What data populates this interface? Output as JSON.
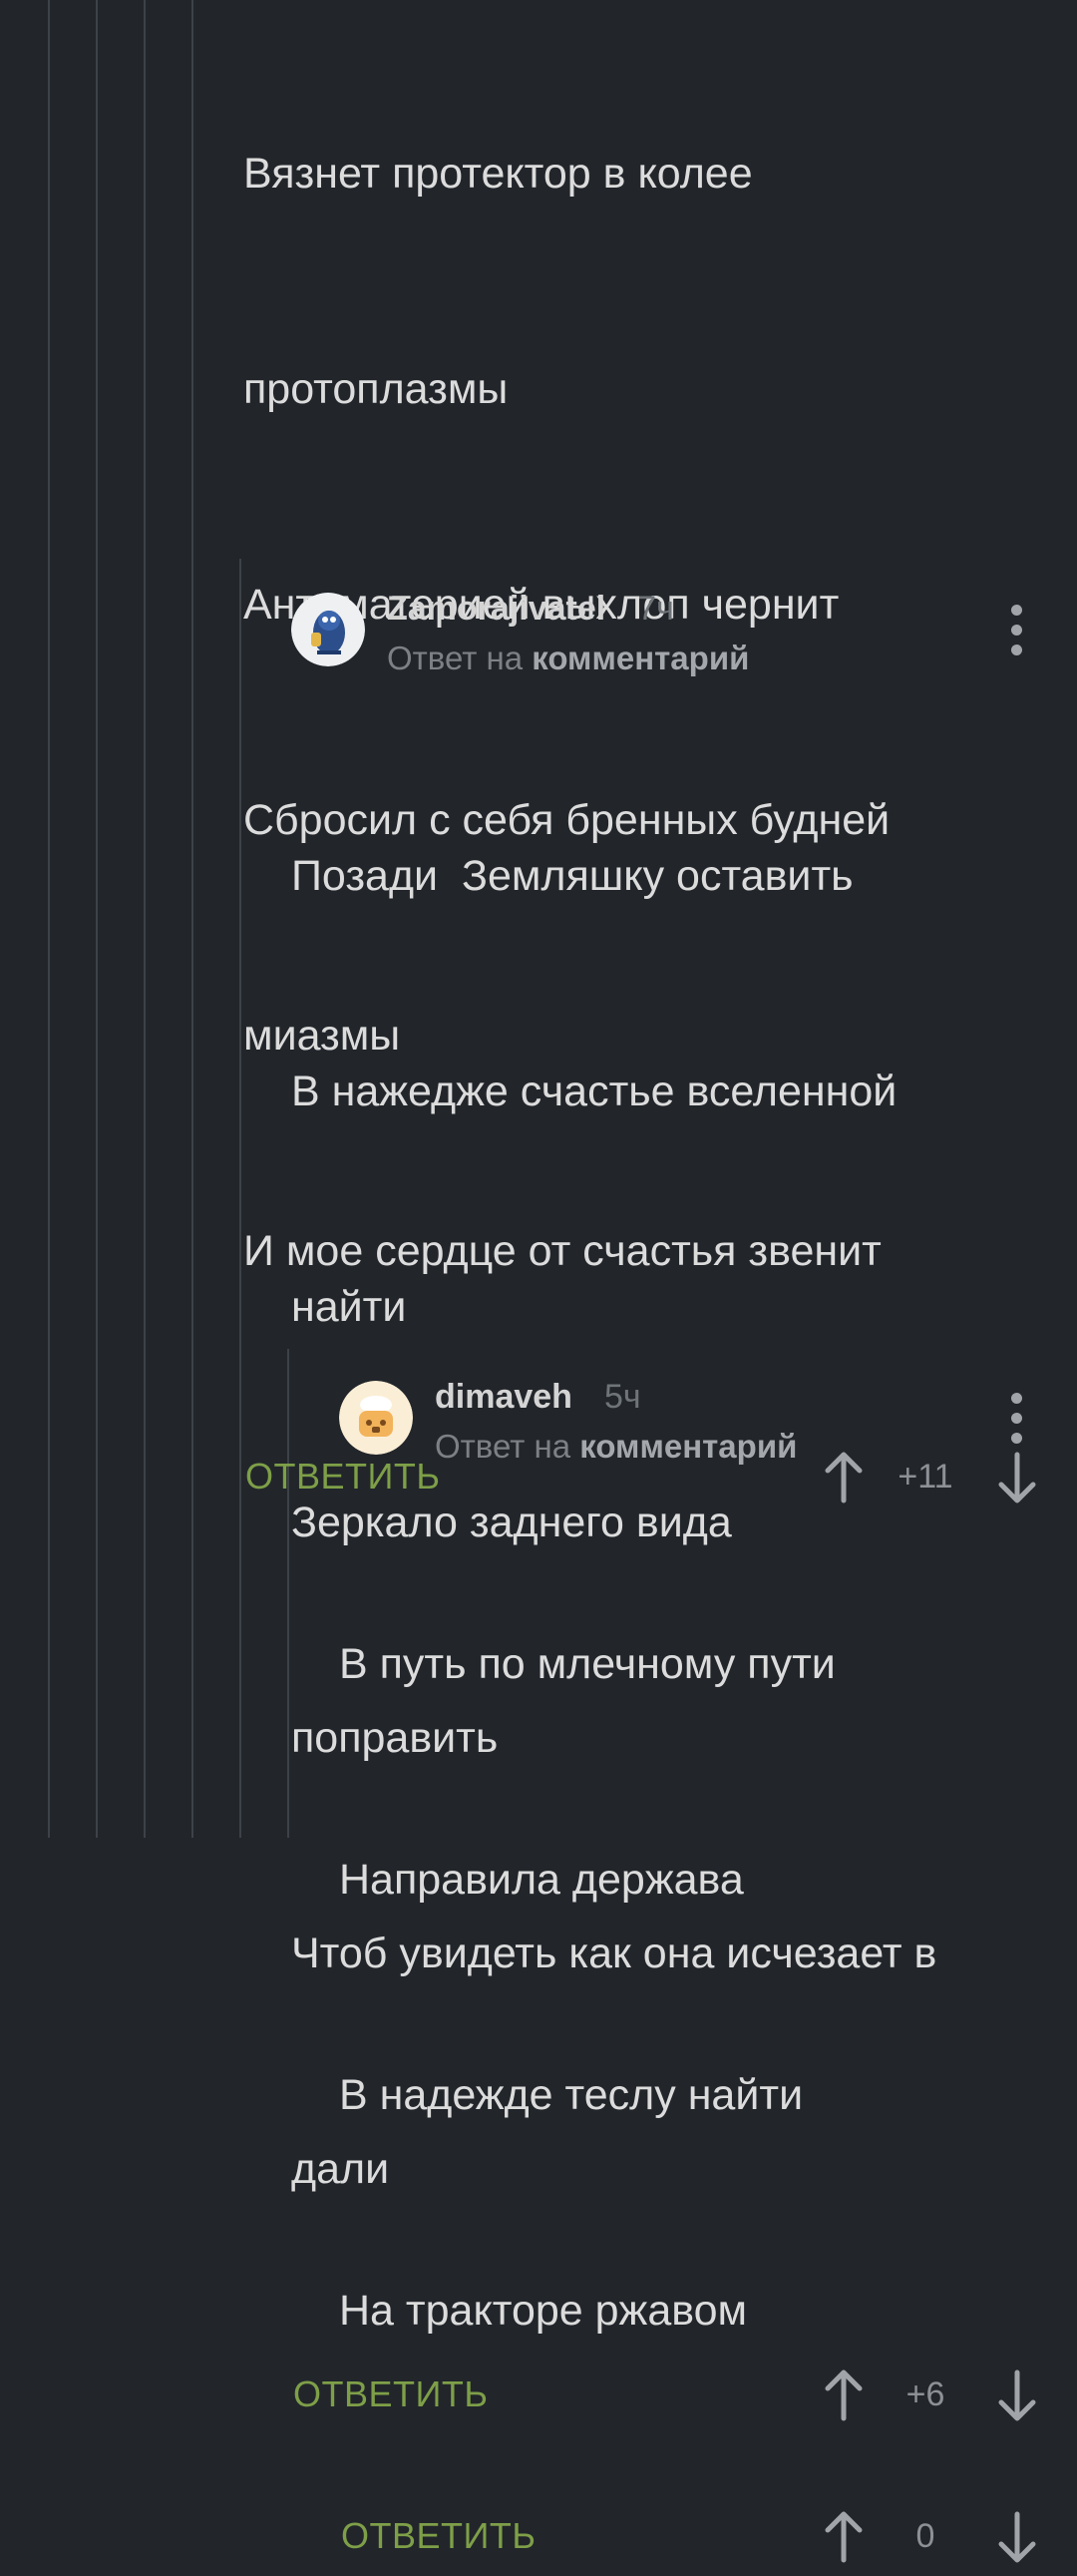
{
  "comment_top": {
    "lines": [
      "Вязнет протектор в колее",
      "протоплазмы",
      "Антиматерией выхлоп чернит",
      "Сбросил с себя бренных будней",
      "миазмы",
      "И мое сердце от счастья звенит"
    ],
    "reply_label": "ОТВЕТИТЬ",
    "score": "+11"
  },
  "comment_2": {
    "username": "Zamorajivatel",
    "time": "7ч",
    "reply_to_prefix": "Ответ на",
    "reply_to_target": "комментарий",
    "lines": [
      "Позади  Земляшку оставить",
      "В нажедже счастье вселенной",
      "найти",
      "Зеркало заднего вида",
      "поправить",
      "Чтоб увидеть как она исчезает в",
      "дали"
    ],
    "reply_label": "ОТВЕТИТЬ",
    "score": "+6"
  },
  "comment_3": {
    "username": "dimaveh",
    "time": "5ч",
    "reply_to_prefix": "Ответ на",
    "reply_to_target": "комментарий",
    "lines": [
      "В путь по млечному пути",
      "Направила держава",
      "В надежде теслу найти",
      "На тракторе ржавом"
    ],
    "reply_label": "ОТВЕТИТЬ",
    "score": "0"
  },
  "colors": {
    "background": "#22262b",
    "accent_green": "#7e9f48",
    "thread_line": "#3d4248"
  }
}
